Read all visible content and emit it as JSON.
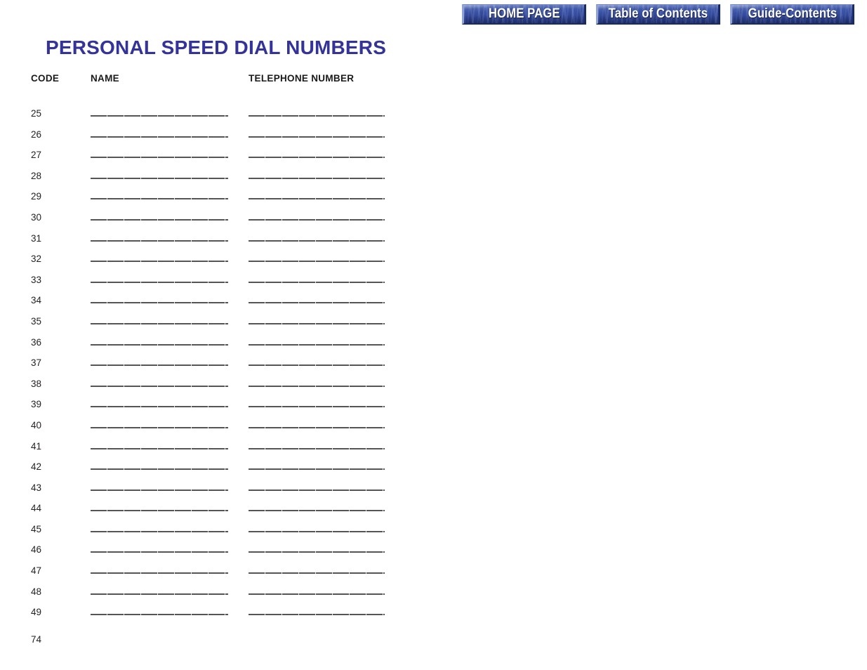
{
  "nav": {
    "buttons": [
      {
        "label": "HOME PAGE",
        "name": "nav-home-page"
      },
      {
        "label": "Table of Contents",
        "name": "nav-table-of-contents"
      },
      {
        "label": "Guide-Contents",
        "name": "nav-guide-contents"
      }
    ],
    "accent_color": "#3b54ab",
    "text_color": "#ffffff"
  },
  "page": {
    "title": "PERSONAL SPEED DIAL NUMBERS",
    "title_color": "#333399",
    "page_number": "74",
    "background_color": "#ffffff"
  },
  "table": {
    "columns": [
      {
        "key": "code",
        "label": "CODE"
      },
      {
        "key": "name",
        "label": "NAME"
      },
      {
        "key": "phone",
        "label": "TELEPHONE NUMBER"
      }
    ],
    "rows": [
      {
        "code": "25",
        "name": "",
        "phone": ""
      },
      {
        "code": "26",
        "name": "",
        "phone": ""
      },
      {
        "code": "27",
        "name": "",
        "phone": ""
      },
      {
        "code": "28",
        "name": "",
        "phone": ""
      },
      {
        "code": "29",
        "name": "",
        "phone": ""
      },
      {
        "code": "30",
        "name": "",
        "phone": ""
      },
      {
        "code": "31",
        "name": "",
        "phone": ""
      },
      {
        "code": "32",
        "name": "",
        "phone": ""
      },
      {
        "code": "33",
        "name": "",
        "phone": ""
      },
      {
        "code": "34",
        "name": "",
        "phone": ""
      },
      {
        "code": "35",
        "name": "",
        "phone": ""
      },
      {
        "code": "36",
        "name": "",
        "phone": ""
      },
      {
        "code": "37",
        "name": "",
        "phone": ""
      },
      {
        "code": "38",
        "name": "",
        "phone": ""
      },
      {
        "code": "39",
        "name": "",
        "phone": ""
      },
      {
        "code": "40",
        "name": "",
        "phone": ""
      },
      {
        "code": "41",
        "name": "",
        "phone": ""
      },
      {
        "code": "42",
        "name": "",
        "phone": ""
      },
      {
        "code": "43",
        "name": "",
        "phone": ""
      },
      {
        "code": "44",
        "name": "",
        "phone": ""
      },
      {
        "code": "45",
        "name": "",
        "phone": ""
      },
      {
        "code": "46",
        "name": "",
        "phone": ""
      },
      {
        "code": "47",
        "name": "",
        "phone": ""
      },
      {
        "code": "48",
        "name": "",
        "phone": ""
      },
      {
        "code": "49",
        "name": "",
        "phone": ""
      }
    ]
  }
}
